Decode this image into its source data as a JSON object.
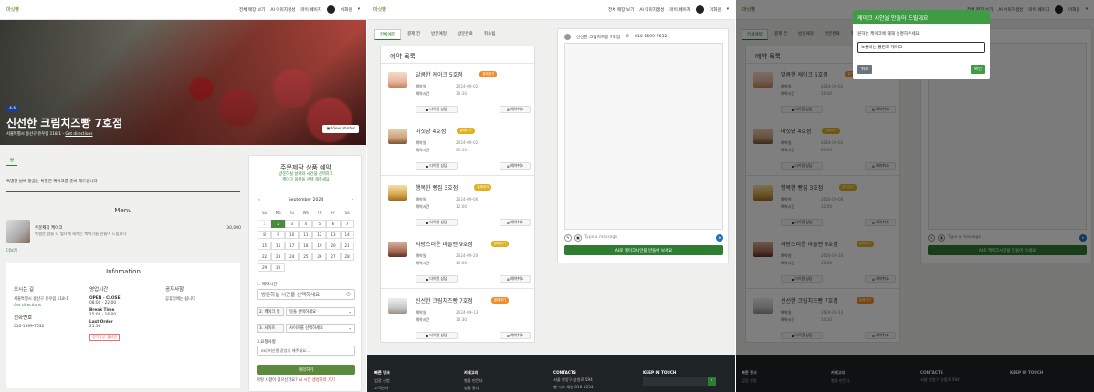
{
  "nav": {
    "logo": "마싯빵",
    "links": [
      "전체 매장 보기",
      "AI 이미지생성",
      "마이 페이지"
    ],
    "user": "이화윤",
    "caret": "▾"
  },
  "store": {
    "rating": "4.5",
    "name": "신선한 크림치즈빵 7호점",
    "address": "서울특별시 용산구 유우림 118-1",
    "directions": "Get directions",
    "view_photos": "View photos",
    "tab": "빵",
    "description": "특별한 날에 깔끔는 특별한 케이크를 준비 해드립니다"
  },
  "menu": {
    "title": "Menu",
    "item_name": "주문제작 케이크",
    "item_desc": "특별한 날을 더 빛나게 해주는 케이크를 만들어 드립니다",
    "price": "30,000",
    "more": "더보기"
  },
  "info": {
    "title": "Infomation",
    "location_h": "오시는 길",
    "location_addr": "서울특별시 용산구 유우림 118-1",
    "location_dir": "Get directions",
    "phone_h": "전화번호",
    "phone": "010-1599-7632",
    "hours_h": "영업시간",
    "open_label": "OPEN - CLOSE",
    "open_time": "08:00 - 22:00",
    "break_label": "Break Time",
    "break_time": "15:00 - 16:00",
    "last_label": "Last Order",
    "last_time": "21:30",
    "closed_badge": "정기휴무 월요일",
    "notice_h": "공지사항",
    "notice": "공휴일에는 쉽니다"
  },
  "reserve": {
    "title": "주문제작 상품 예약",
    "sub1": "방문하실 날짜와 시간을 선택하고",
    "sub2": "케이크 옵션을 선택 해주세요",
    "prev": "‹",
    "month": "September 2024",
    "next": "›",
    "dow": [
      "Su",
      "Mo",
      "Tu",
      "We",
      "Th",
      "Fr",
      "Sa"
    ],
    "days": [
      "1",
      "2",
      "3",
      "4",
      "5",
      "6",
      "7",
      "8",
      "9",
      "10",
      "11",
      "12",
      "13",
      "14",
      "15",
      "16",
      "17",
      "18",
      "19",
      "20",
      "21",
      "22",
      "23",
      "24",
      "25",
      "26",
      "27",
      "28",
      "29",
      "30"
    ],
    "selected_day": "2",
    "time_label": "1. 예약시간",
    "time_placeholder": "방문하실 시간을 선택하세요",
    "opt1_label": "2. 케이크 맛",
    "opt1_value": "맛을 선택하세요",
    "opt2_label": "3. 사이즈",
    "opt2_value": "사이즈를 선택하세요",
    "req_label": "3.요청사항",
    "req_placeholder": "ex) 머신컬 같았기 해주세요...",
    "submit": "예약하기",
    "footer_q": "마땅 사항이 없으신가요?",
    "footer_link": "AI 시안 생성하러 가기"
  },
  "orders": {
    "tabs": [
      "전체예약",
      "결제 전",
      "방문예정",
      "방문완료",
      "취소됨"
    ],
    "title": "예약 목록",
    "date_label": "예약일",
    "time_label": "예약시간",
    "chat_btn": "다이얼 상담",
    "cancel_btn": "예약취소",
    "items": [
      {
        "name": "달콤한 케이크 5호점",
        "status": "결제대기",
        "status_color": "#f28c28",
        "date": "2024-09-02",
        "time": "10:30"
      },
      {
        "name": "마싯당 4호점",
        "status": "결제대기",
        "status_color": "#e0b020",
        "date": "2024-09-02",
        "time": "09:30"
      },
      {
        "name": "행복한 빵집 3호점",
        "status": "결제대기",
        "status_color": "#e0b020",
        "date": "2024-09-06",
        "time": "12:00"
      },
      {
        "name": "사랑스러운 마들렌 9호점",
        "status": "결제대기",
        "status_color": "#e0b020",
        "date": "2024-09-20",
        "time": "10:00"
      },
      {
        "name": "신선한 크림치즈빵 7호점",
        "status": "결제대기",
        "status_color": "#f28c28",
        "date": "2024-09-13",
        "time": "10:30"
      }
    ]
  },
  "chat": {
    "shop": "신선한 크림치즈빵 7호점",
    "phone": "010-1599-7632",
    "placeholder": "Type a message",
    "ai_button": "AI로 케이크시안을 만들어 보세요"
  },
  "footer": {
    "col1_h": "빠른 링크",
    "col1_items": [
      "업장 신청",
      "고객센터"
    ],
    "col2_h": "카테고리",
    "col2_items": [
      "빵을 만든다",
      "빵을 팔다"
    ],
    "col3_h": "CONTACTS",
    "col3_items": [
      "서울 양양구 상원로 594",
      "빵 사요 제발 010-1234"
    ],
    "col4_h": "KEEP IN TOUCH"
  },
  "modal": {
    "title": "케이크 시안을 만들어 드릴게요",
    "body": "원하는 케이크에 대해 설명하주세요.",
    "input_value": "노을바는 올린과 케이크",
    "cancel": "취소",
    "ok": "확인"
  },
  "colors": {
    "accent": "#3f9b44",
    "dark_footer": "#1e2326",
    "rating": "#1f3d8a"
  }
}
